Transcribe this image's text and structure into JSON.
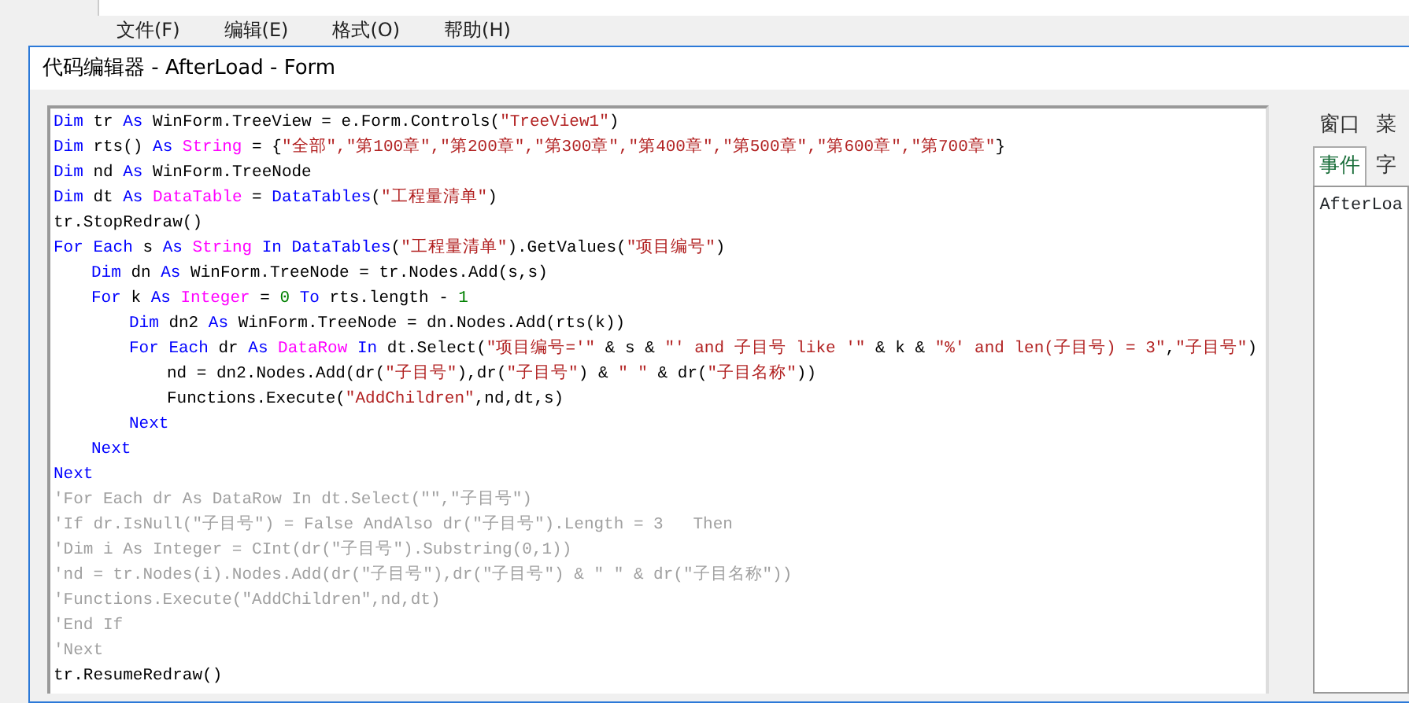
{
  "background_window": {
    "menu": [
      "文件(F)",
      "编辑(E)",
      "格式(O)",
      "帮助(H)"
    ]
  },
  "dialog": {
    "title": "代码编辑器 - AfterLoad - Form",
    "code_lines": [
      {
        "tokens": [
          {
            "kind": "keyword",
            "text": "Dim"
          },
          {
            "kind": "plain",
            "text": " tr "
          },
          {
            "kind": "keyword",
            "text": "As"
          },
          {
            "kind": "plain",
            "text": " WinForm.TreeView = e.Form.Controls("
          },
          {
            "kind": "string",
            "text": "\"TreeView1\""
          },
          {
            "kind": "plain",
            "text": ")"
          }
        ]
      },
      {
        "tokens": [
          {
            "kind": "keyword",
            "text": "Dim"
          },
          {
            "kind": "plain",
            "text": " rts() "
          },
          {
            "kind": "keyword",
            "text": "As "
          },
          {
            "kind": "type",
            "text": "String"
          },
          {
            "kind": "plain",
            "text": " = {"
          },
          {
            "kind": "string",
            "text": "\"全部\",\"第100章\",\"第200章\",\"第300章\",\"第400章\",\"第500章\",\"第600章\",\"第700章\""
          },
          {
            "kind": "plain",
            "text": "}"
          }
        ]
      },
      {
        "tokens": [
          {
            "kind": "keyword",
            "text": "Dim"
          },
          {
            "kind": "plain",
            "text": " nd "
          },
          {
            "kind": "keyword",
            "text": "As"
          },
          {
            "kind": "plain",
            "text": " WinForm.TreeNode"
          }
        ]
      },
      {
        "tokens": [
          {
            "kind": "keyword",
            "text": "Dim"
          },
          {
            "kind": "plain",
            "text": " dt "
          },
          {
            "kind": "keyword",
            "text": "As "
          },
          {
            "kind": "type",
            "text": "DataTable"
          },
          {
            "kind": "plain",
            "text": " = "
          },
          {
            "kind": "keyword",
            "text": "DataTables"
          },
          {
            "kind": "plain",
            "text": "("
          },
          {
            "kind": "string",
            "text": "\"工程量清单\""
          },
          {
            "kind": "plain",
            "text": ")"
          }
        ]
      },
      {
        "tokens": [
          {
            "kind": "plain",
            "text": "tr.StopRedraw()"
          }
        ]
      },
      {
        "tokens": [
          {
            "kind": "keyword",
            "text": "For Each"
          },
          {
            "kind": "plain",
            "text": " s "
          },
          {
            "kind": "keyword",
            "text": "As "
          },
          {
            "kind": "type",
            "text": "String "
          },
          {
            "kind": "keyword",
            "text": "In DataTables"
          },
          {
            "kind": "plain",
            "text": "("
          },
          {
            "kind": "string",
            "text": "\"工程量清单\""
          },
          {
            "kind": "plain",
            "text": ").GetValues("
          },
          {
            "kind": "string",
            "text": "\"项目编号\""
          },
          {
            "kind": "plain",
            "text": ")"
          }
        ],
        "children": [
          {
            "tokens": [
              {
                "kind": "keyword",
                "text": "Dim"
              },
              {
                "kind": "plain",
                "text": " dn "
              },
              {
                "kind": "keyword",
                "text": "As"
              },
              {
                "kind": "plain",
                "text": " WinForm.TreeNode = tr.Nodes.Add(s,s)"
              }
            ]
          },
          {
            "tokens": [
              {
                "kind": "keyword",
                "text": "For"
              },
              {
                "kind": "plain",
                "text": " k "
              },
              {
                "kind": "keyword",
                "text": "As "
              },
              {
                "kind": "type",
                "text": "Integer"
              },
              {
                "kind": "plain",
                "text": " = "
              },
              {
                "kind": "number",
                "text": "0"
              },
              {
                "kind": "keyword",
                "text": " To"
              },
              {
                "kind": "plain",
                "text": " rts.length - "
              },
              {
                "kind": "number",
                "text": "1"
              }
            ],
            "children": [
              {
                "tokens": [
                  {
                    "kind": "keyword",
                    "text": "Dim"
                  },
                  {
                    "kind": "plain",
                    "text": " dn2 "
                  },
                  {
                    "kind": "keyword",
                    "text": "As"
                  },
                  {
                    "kind": "plain",
                    "text": " WinForm.TreeNode = dn.Nodes.Add(rts(k))"
                  }
                ]
              },
              {
                "tokens": [
                  {
                    "kind": "keyword",
                    "text": "For Each"
                  },
                  {
                    "kind": "plain",
                    "text": " dr "
                  },
                  {
                    "kind": "keyword",
                    "text": "As "
                  },
                  {
                    "kind": "type",
                    "text": "DataRow "
                  },
                  {
                    "kind": "keyword",
                    "text": "In"
                  },
                  {
                    "kind": "plain",
                    "text": " dt.Select("
                  },
                  {
                    "kind": "string",
                    "text": "\"项目编号='\""
                  },
                  {
                    "kind": "plain",
                    "text": " & s & "
                  },
                  {
                    "kind": "string",
                    "text": "\"' and 子目号 like '\""
                  },
                  {
                    "kind": "plain",
                    "text": " & k & "
                  },
                  {
                    "kind": "string",
                    "text": "\"%' and len(子目号) = 3\""
                  },
                  {
                    "kind": "plain",
                    "text": ","
                  },
                  {
                    "kind": "string",
                    "text": "\"子目号\""
                  },
                  {
                    "kind": "plain",
                    "text": ")"
                  }
                ],
                "children": [
                  {
                    "tokens": [
                      {
                        "kind": "plain",
                        "text": "nd = dn2.Nodes.Add(dr("
                      },
                      {
                        "kind": "string",
                        "text": "\"子目号\""
                      },
                      {
                        "kind": "plain",
                        "text": "),dr("
                      },
                      {
                        "kind": "string",
                        "text": "\"子目号\""
                      },
                      {
                        "kind": "plain",
                        "text": ") & "
                      },
                      {
                        "kind": "string",
                        "text": "\" \""
                      },
                      {
                        "kind": "plain",
                        "text": " & dr("
                      },
                      {
                        "kind": "string",
                        "text": "\"子目名称\""
                      },
                      {
                        "kind": "plain",
                        "text": "))"
                      }
                    ]
                  },
                  {
                    "tokens": [
                      {
                        "kind": "plain",
                        "text": "Functions.Execute("
                      },
                      {
                        "kind": "string",
                        "text": "\"AddChildren\""
                      },
                      {
                        "kind": "plain",
                        "text": ",nd,dt,s)"
                      }
                    ]
                  }
                ]
              },
              {
                "tokens": [
                  {
                    "kind": "keyword",
                    "text": "Next"
                  }
                ]
              }
            ]
          },
          {
            "tokens": [
              {
                "kind": "keyword",
                "text": "Next"
              }
            ]
          }
        ]
      },
      {
        "tokens": [
          {
            "kind": "keyword",
            "text": "Next"
          }
        ]
      },
      {
        "tokens": [
          {
            "kind": "comment",
            "text": "'For Each dr As DataRow In dt.Select(\"\",\"子目号\")"
          }
        ]
      },
      {
        "tokens": [
          {
            "kind": "comment",
            "text": "'If dr.IsNull(\"子目号\") = False AndAlso dr(\"子目号\").Length = 3   Then"
          }
        ]
      },
      {
        "tokens": [
          {
            "kind": "comment",
            "text": "'Dim i As Integer = CInt(dr(\"子目号\").Substring(0,1))"
          }
        ]
      },
      {
        "tokens": [
          {
            "kind": "comment",
            "text": "'nd = tr.Nodes(i).Nodes.Add(dr(\"子目号\"),dr(\"子目号\") & \" \" & dr(\"子目名称\"))"
          }
        ]
      },
      {
        "tokens": [
          {
            "kind": "comment",
            "text": "'Functions.Execute(\"AddChildren\",nd,dt)"
          }
        ]
      },
      {
        "tokens": [
          {
            "kind": "comment",
            "text": "'End If"
          }
        ]
      },
      {
        "tokens": [
          {
            "kind": "comment",
            "text": "'Next"
          }
        ]
      },
      {
        "tokens": [
          {
            "kind": "plain",
            "text": "tr.ResumeRedraw()"
          }
        ]
      }
    ],
    "side_panel": {
      "tab_rows": [
        {
          "tabs": [
            {
              "label": "窗口",
              "selected": false
            },
            {
              "label": "菜",
              "selected": false
            }
          ]
        },
        {
          "tabs": [
            {
              "label": "事件",
              "selected": true
            },
            {
              "label": "字",
              "selected": false
            }
          ]
        }
      ],
      "events": [
        "AfterLoa"
      ]
    }
  }
}
